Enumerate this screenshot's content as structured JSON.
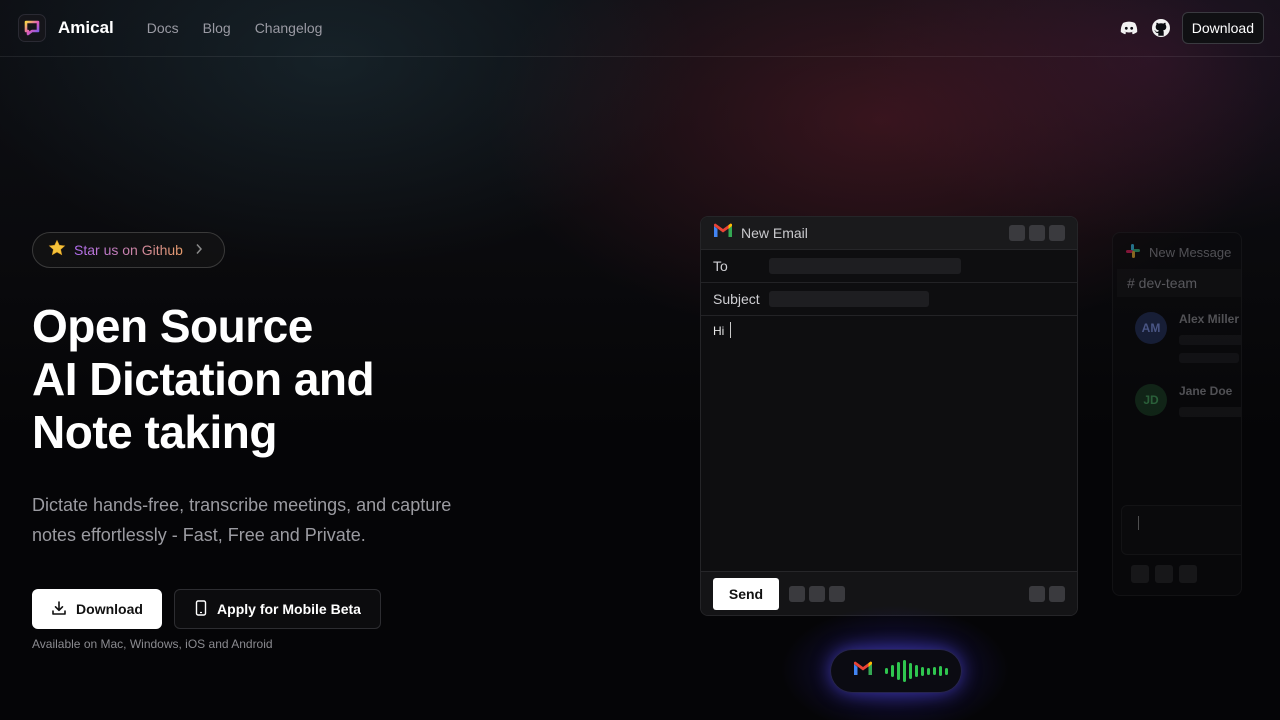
{
  "nav": {
    "brand": "Amical",
    "links": [
      "Docs",
      "Blog",
      "Changelog"
    ],
    "download": "Download",
    "icons": [
      "discord-icon",
      "github-icon"
    ]
  },
  "hero": {
    "pill": "Star us on Github",
    "title_lines": [
      "Open Source",
      "AI Dictation and",
      "Note taking"
    ],
    "subtitle": "Dictate hands-free, transcribe meetings, and capture notes effortlessly - Fast, Free and Private.",
    "download_button": "Download",
    "mobile_button": "Apply for Mobile Beta",
    "availability": "Available on Mac, Windows, iOS and Android"
  },
  "email": {
    "title": "New Email",
    "to_label": "To",
    "subject_label": "Subject",
    "body": "Hi",
    "send": "Send"
  },
  "slack": {
    "title": "New Message",
    "channel": "# dev-team",
    "users": [
      {
        "initials": "AM",
        "name": "Alex Miller"
      },
      {
        "initials": "JD",
        "name": "Jane Doe"
      }
    ]
  },
  "colors": {
    "accent_wave": "#2fc64f",
    "voice_glow": "#5a50ff",
    "pill_gradient_start": "#b06cf0",
    "pill_gradient_end": "#e49a6a"
  }
}
